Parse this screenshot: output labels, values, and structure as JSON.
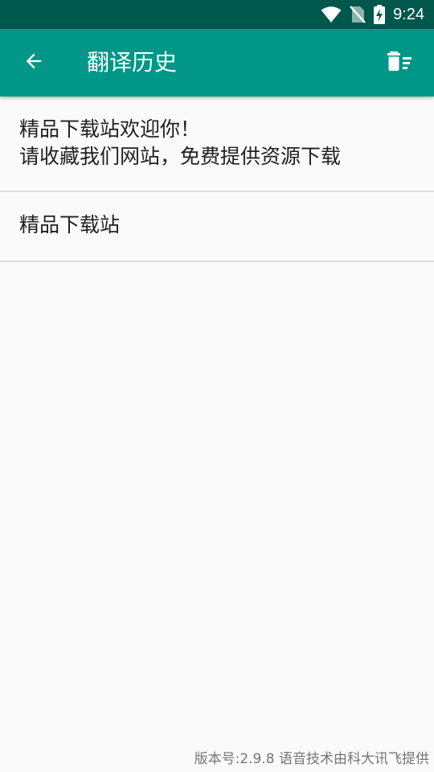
{
  "status_bar": {
    "time": "9:24",
    "icons": [
      "wifi-icon",
      "no-sim-icon",
      "battery-charging-icon"
    ]
  },
  "app_bar": {
    "title": "翻译历史",
    "back_icon": "arrow-back-icon",
    "action_icon": "delete-sweep-icon",
    "background": "#009688"
  },
  "history": {
    "items": [
      {
        "lines": [
          "精品下载站欢迎你！",
          "请收藏我们网站，免费提供资源下载"
        ]
      },
      {
        "lines": [
          "精品下载站"
        ]
      }
    ]
  },
  "footer": {
    "text": "版本号:2.9.8 语音技术由科大讯飞提供"
  },
  "colors": {
    "status_bar": "#00574b",
    "accent": "#009688",
    "background": "#fafafa",
    "divider": "#dddddd"
  }
}
